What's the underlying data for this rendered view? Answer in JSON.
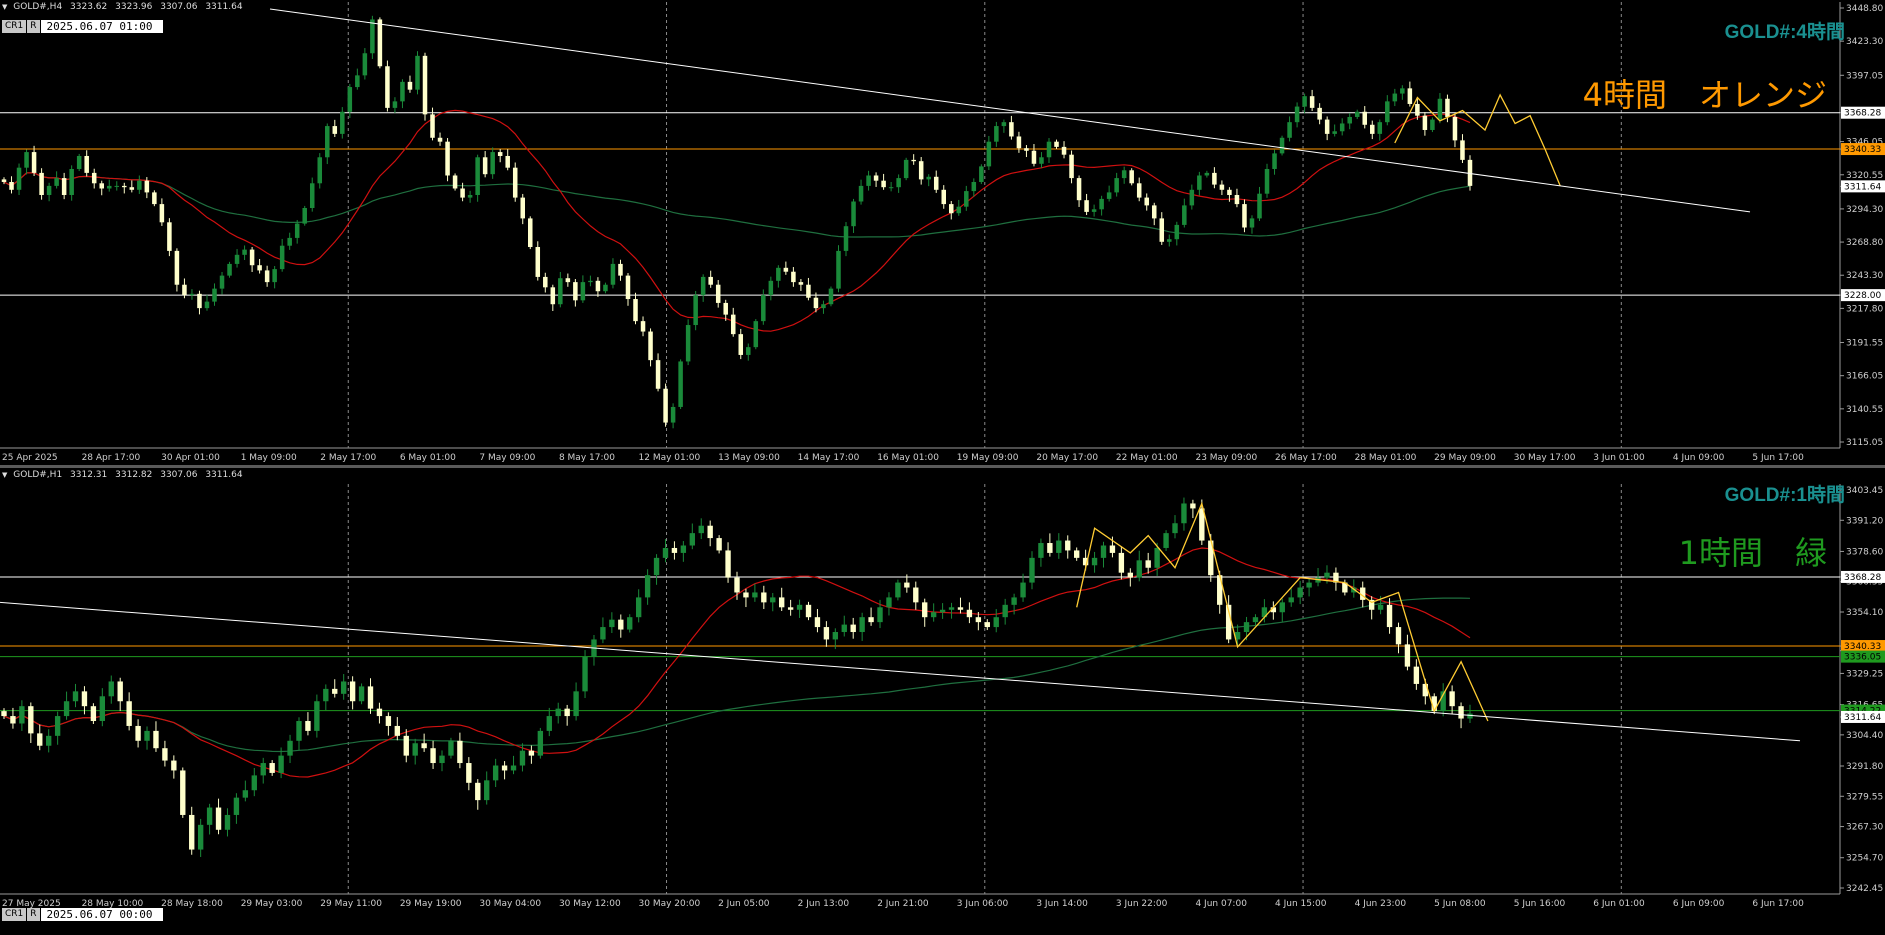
{
  "top_panel": {
    "info": {
      "symbol": "GOLD#,H4",
      "open": "3323.62",
      "high": "3323.96",
      "low": "3307.06",
      "close": "3311.64"
    },
    "tag_r1": "CR1",
    "tag_r2": "R",
    "tag_date": "2025.06.07 01:00",
    "symbol_label": "GOLD#:4時間",
    "big_label": "4時間　オレンジ"
  },
  "bottom_panel": {
    "info": {
      "symbol": "GOLD#,H1",
      "open": "3312.31",
      "high": "3312.82",
      "low": "3307.06",
      "close": "3311.64"
    },
    "tag_r1": "CR1",
    "tag_r2": "R",
    "tag_date": "2025.06.07 00:00",
    "symbol_label": "GOLD#:1時間",
    "big_label": "1時間　緑"
  },
  "colors": {
    "bull": "#1a8a3a",
    "bear": "#ffffcc",
    "ma_fast": "#d01010",
    "ma_slow": "#1f6f3f",
    "zigzag": "#ffcc33",
    "orange_line": "#ff9900",
    "green_line": "#1f9a1f",
    "white_line": "#ffffff",
    "grid": "#8a8a8a",
    "axis_text": "#cfcfcf"
  },
  "chart_data": [
    {
      "type": "candlestick",
      "timeframe": "H4",
      "ylim": [
        3115.05,
        3448.8
      ],
      "y_ticks": [
        "3448.80",
        "3423.30",
        "3397.05",
        "3368.28",
        "3346.05",
        "3340.33",
        "3320.55",
        "3311.64",
        "3294.30",
        "3268.80",
        "3243.30",
        "3228.00",
        "3217.80",
        "3191.55",
        "3166.05",
        "3140.55",
        "3115.05"
      ],
      "x_ticks": [
        "25 Apr 2025",
        "28 Apr 17:00",
        "30 Apr 01:00",
        "1 May 09:00",
        "2 May 17:00",
        "6 May 01:00",
        "7 May 09:00",
        "8 May 17:00",
        "12 May 01:00",
        "13 May 09:00",
        "14 May 17:00",
        "16 May 01:00",
        "19 May 09:00",
        "20 May 17:00",
        "22 May 01:00",
        "23 May 09:00",
        "26 May 17:00",
        "28 May 01:00",
        "29 May 09:00",
        "30 May 17:00",
        "3 Jun 01:00",
        "4 Jun 09:00",
        "5 Jun 17:00"
      ],
      "price_levels": [
        {
          "value": 3368.28,
          "label": "3368.28",
          "color": "#ffffff"
        },
        {
          "value": 3340.33,
          "label": "3340.33",
          "color": "#ff9900"
        },
        {
          "value": 3311.64,
          "label": "3311.64",
          "color": "#ffffff"
        },
        {
          "value": 3228.0,
          "label": "3228.00",
          "color": "#ffffff"
        }
      ],
      "closes": [
        3315,
        3309,
        3326,
        3338,
        3322,
        3305,
        3312,
        3318,
        3305,
        3325,
        3335,
        3322,
        3314,
        3310,
        3312,
        3312,
        3311,
        3309,
        3316,
        3307,
        3298,
        3284,
        3262,
        3236,
        3228,
        3229,
        3218,
        3223,
        3233,
        3243,
        3252,
        3259,
        3263,
        3251,
        3247,
        3238,
        3248,
        3266,
        3272,
        3283,
        3295,
        3314,
        3334,
        3358,
        3352,
        3369,
        3388,
        3397,
        3414,
        3440,
        3404,
        3372,
        3377,
        3392,
        3386,
        3412,
        3367,
        3349,
        3346,
        3320,
        3310,
        3303,
        3305,
        3334,
        3321,
        3338,
        3335,
        3326,
        3303,
        3287,
        3265,
        3242,
        3234,
        3221,
        3241,
        3238,
        3224,
        3238,
        3239,
        3231,
        3236,
        3252,
        3243,
        3225,
        3208,
        3200,
        3178,
        3156,
        3130,
        3142,
        3177,
        3205,
        3228,
        3242,
        3236,
        3222,
        3213,
        3198,
        3182,
        3188,
        3208,
        3228,
        3239,
        3249,
        3246,
        3238,
        3236,
        3226,
        3218,
        3221,
        3233,
        3262,
        3281,
        3300,
        3312,
        3320,
        3316,
        3311,
        3311,
        3318,
        3332,
        3331,
        3317,
        3319,
        3309,
        3298,
        3291,
        3296,
        3308,
        3315,
        3327,
        3346,
        3358,
        3361,
        3350,
        3341,
        3339,
        3329,
        3334,
        3346,
        3342,
        3336,
        3318,
        3301,
        3292,
        3294,
        3302,
        3307,
        3318,
        3324,
        3314,
        3303,
        3297,
        3287,
        3269,
        3271,
        3282,
        3297,
        3309,
        3320,
        3322,
        3313,
        3309,
        3305,
        3298,
        3280,
        3287,
        3306,
        3325,
        3337,
        3349,
        3361,
        3373,
        3381,
        3372,
        3363,
        3352,
        3354,
        3360,
        3365,
        3369,
        3359,
        3352,
        3361,
        3377,
        3383,
        3387,
        3375,
        3366,
        3355,
        3363,
        3379,
        3365,
        3347,
        3332,
        3312
      ]
    },
    {
      "type": "candlestick",
      "timeframe": "H1",
      "ylim": [
        3242.45,
        3403.45
      ],
      "y_ticks": [
        "3403.45",
        "3391.20",
        "3378.60",
        "3368.28",
        "3366.35",
        "3354.10",
        "3340.33",
        "3338.45",
        "3329.25",
        "3316.65",
        "3311.64",
        "3304.40",
        "3291.80",
        "3279.55",
        "3267.30",
        "3254.70",
        "3242.45"
      ],
      "x_ticks": [
        "27 May 2025",
        "28 May 10:00",
        "28 May 18:00",
        "29 May 03:00",
        "29 May 11:00",
        "29 May 19:00",
        "30 May 04:00",
        "30 May 12:00",
        "30 May 20:00",
        "2 Jun 05:00",
        "2 Jun 13:00",
        "2 Jun 21:00",
        "3 Jun 06:00",
        "3 Jun 14:00",
        "3 Jun 22:00",
        "4 Jun 07:00",
        "4 Jun 15:00",
        "4 Jun 23:00",
        "5 Jun 08:00",
        "5 Jun 16:00",
        "6 Jun 01:00",
        "6 Jun 09:00",
        "6 Jun 17:00"
      ],
      "price_levels": [
        {
          "value": 3368.28,
          "label": "3368.28",
          "color": "#ffffff"
        },
        {
          "value": 3340.33,
          "label": "3340.33",
          "color": "#ff9900"
        },
        {
          "value": 3336.05,
          "label": "3336.05",
          "color": "#1f9a1f"
        },
        {
          "value": 3314.22,
          "label": "3314.22",
          "color": "#1f9a1f"
        },
        {
          "value": 3311.64,
          "label": "3311.64",
          "color": "#ffffff"
        }
      ],
      "closes": [
        3312,
        3309,
        3316,
        3305,
        3300,
        3304,
        3312,
        3318,
        3322,
        3316,
        3310,
        3320,
        3326,
        3318,
        3308,
        3302,
        3306,
        3299,
        3294,
        3290,
        3272,
        3258,
        3268,
        3275,
        3266,
        3272,
        3279,
        3282,
        3288,
        3293,
        3289,
        3296,
        3302,
        3310,
        3306,
        3318,
        3323,
        3321,
        3326,
        3318,
        3324,
        3315,
        3312,
        3308,
        3304,
        3296,
        3301,
        3299,
        3293,
        3296,
        3302,
        3293,
        3285,
        3278,
        3286,
        3292,
        3290,
        3292,
        3298,
        3296,
        3306,
        3312,
        3315,
        3312,
        3322,
        3336,
        3343,
        3348,
        3351,
        3347,
        3352,
        3360,
        3369,
        3376,
        3380,
        3378,
        3381,
        3386,
        3389,
        3384,
        3379,
        3368,
        3362,
        3360,
        3362,
        3358,
        3360,
        3356,
        3355,
        3357,
        3352,
        3348,
        3343,
        3346,
        3349,
        3346,
        3352,
        3350,
        3356,
        3360,
        3366,
        3364,
        3358,
        3352,
        3354,
        3355,
        3356,
        3355,
        3352,
        3350,
        3348,
        3352,
        3357,
        3360,
        3366,
        3376,
        3382,
        3378,
        3383,
        3379,
        3376,
        3373,
        3376,
        3381,
        3378,
        3370,
        3368,
        3375,
        3372,
        3380,
        3386,
        3390,
        3398,
        3396,
        3383,
        3369,
        3357,
        3343,
        3346,
        3350,
        3352,
        3356,
        3354,
        3358,
        3360,
        3364,
        3366,
        3368,
        3370,
        3366,
        3362,
        3364,
        3359,
        3355,
        3357,
        3348,
        3341,
        3332,
        3325,
        3320,
        3314,
        3322,
        3316,
        3311,
        3313
      ]
    }
  ]
}
